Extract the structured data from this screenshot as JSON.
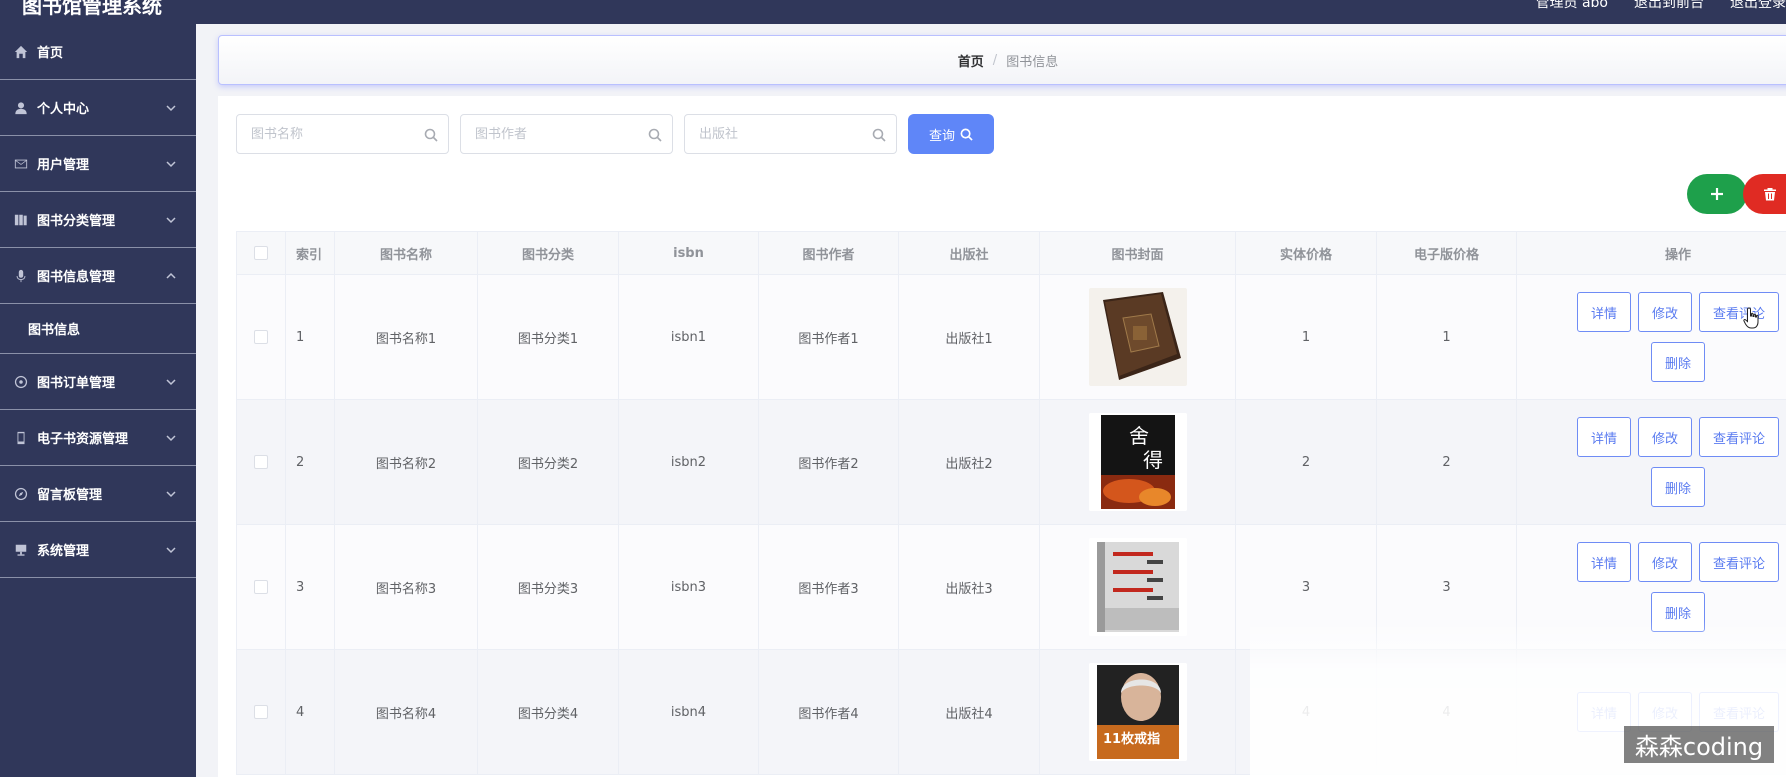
{
  "app": {
    "title": "图书馆管理系统",
    "top_links": [
      "管理员 abo",
      "退出到前台",
      "退出登录"
    ]
  },
  "sidebar": {
    "items": [
      {
        "label": "首页",
        "icon": "home-icon",
        "expandable": false
      },
      {
        "label": "个人中心",
        "icon": "user-icon",
        "expandable": true
      },
      {
        "label": "用户管理",
        "icon": "mail-icon",
        "expandable": true
      },
      {
        "label": "图书分类管理",
        "icon": "book-icon",
        "expandable": true
      },
      {
        "label": "图书信息管理",
        "icon": "microphone-icon",
        "expanded": true
      },
      {
        "label": "图书信息",
        "sub": true
      },
      {
        "label": "图书订单管理",
        "icon": "dial-icon",
        "expandable": true
      },
      {
        "label": "电子书资源管理",
        "icon": "phone-icon",
        "expandable": true
      },
      {
        "label": "留言板管理",
        "icon": "compass-icon",
        "expandable": true
      },
      {
        "label": "系统管理",
        "icon": "monitor-icon",
        "expandable": true
      }
    ]
  },
  "breadcrumb": {
    "home": "首页",
    "separator": "/",
    "current": "图书信息"
  },
  "search": {
    "name_placeholder": "图书名称",
    "author_placeholder": "图书作者",
    "publisher_placeholder": "出版社",
    "query_label": "查询"
  },
  "table": {
    "headers": [
      "索引",
      "图书名称",
      "图书分类",
      "isbn",
      "图书作者",
      "出版社",
      "图书封面",
      "实体价格",
      "电子版价格",
      "操作"
    ],
    "rows": [
      {
        "index": "1",
        "name": "图书名称1",
        "category": "图书分类1",
        "isbn": "isbn1",
        "author": "图书作者1",
        "publisher": "出版社1",
        "price": "1",
        "eprice": "1"
      },
      {
        "index": "2",
        "name": "图书名称2",
        "category": "图书分类2",
        "isbn": "isbn2",
        "author": "图书作者2",
        "publisher": "出版社2",
        "price": "2",
        "eprice": "2"
      },
      {
        "index": "3",
        "name": "图书名称3",
        "category": "图书分类3",
        "isbn": "isbn3",
        "author": "图书作者3",
        "publisher": "出版社3",
        "price": "3",
        "eprice": "3"
      },
      {
        "index": "4",
        "name": "图书名称4",
        "category": "图书分类4",
        "isbn": "isbn4",
        "author": "图书作者4",
        "publisher": "出版社4",
        "price": "4",
        "eprice": "4"
      }
    ],
    "actions": {
      "detail": "详情",
      "edit": "修改",
      "comments": "查看评论",
      "delete": "删除"
    }
  },
  "covers": {
    "row2": {
      "line1": "舍",
      "line2": "得"
    },
    "row4": {
      "line1": "11枚戒指"
    }
  },
  "watermark": "森森coding",
  "colors": {
    "sidebar_bg": "#30375a",
    "primary": "#5f86f8",
    "add_green": "#1ea04b",
    "delete_red": "#e02b23"
  }
}
